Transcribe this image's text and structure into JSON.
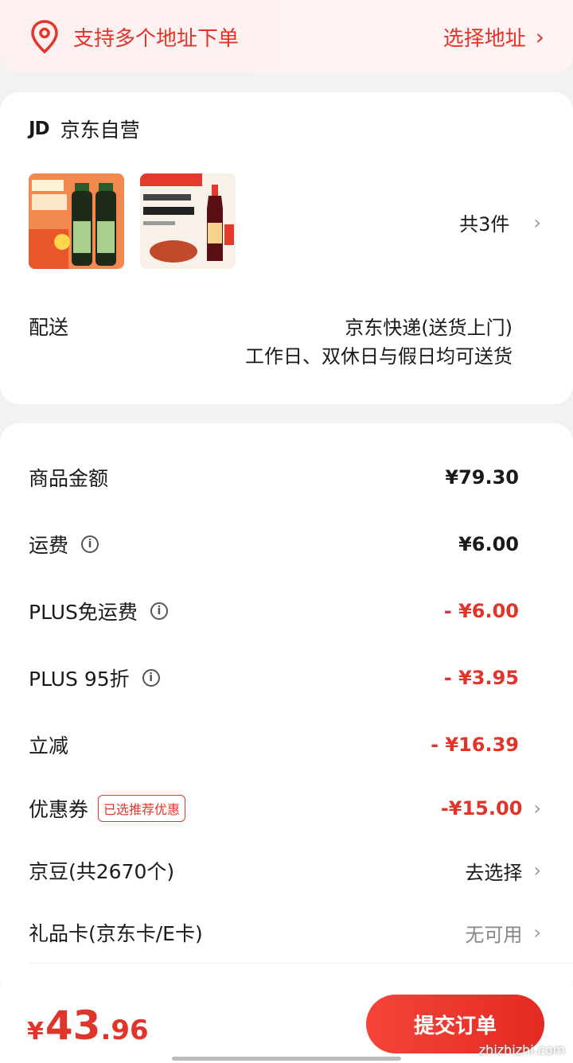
{
  "address": {
    "icon": "location-pin-icon",
    "text": "支持多个地址下单",
    "select_label": "选择地址",
    "accent": "#e0352b"
  },
  "shop": {
    "logo_text": "JD",
    "name": "京东自营",
    "products": [
      {
        "name": "product-soy-sauce"
      },
      {
        "name": "product-vinegar"
      }
    ],
    "count_label": "共3件"
  },
  "shipping": {
    "label": "配送",
    "method": "京东快递(送货上门)",
    "note": "工作日、双休日与假日均可送货"
  },
  "summary": {
    "rows": [
      {
        "label": "商品金额",
        "value": "¥79.30"
      },
      {
        "label": "运费",
        "value": "¥6.00"
      },
      {
        "label": "PLUS免运费",
        "value": "- ¥6.00"
      },
      {
        "label": "PLUS 95折",
        "value": "- ¥3.95"
      },
      {
        "label": "立减",
        "value": "- ¥16.39"
      },
      {
        "label": "优惠券",
        "tag": "已选推荐优惠",
        "value": "-¥15.00"
      },
      {
        "label": "京豆(共2670个)",
        "value": "去选择"
      },
      {
        "label": "礼品卡(京东卡/E卡)",
        "value": "无可用"
      }
    ]
  },
  "footer": {
    "currency": "¥",
    "total_int": "43",
    "total_dec": ".96",
    "submit_label": "提交订单",
    "watermark": "zhizhizhi.com"
  }
}
